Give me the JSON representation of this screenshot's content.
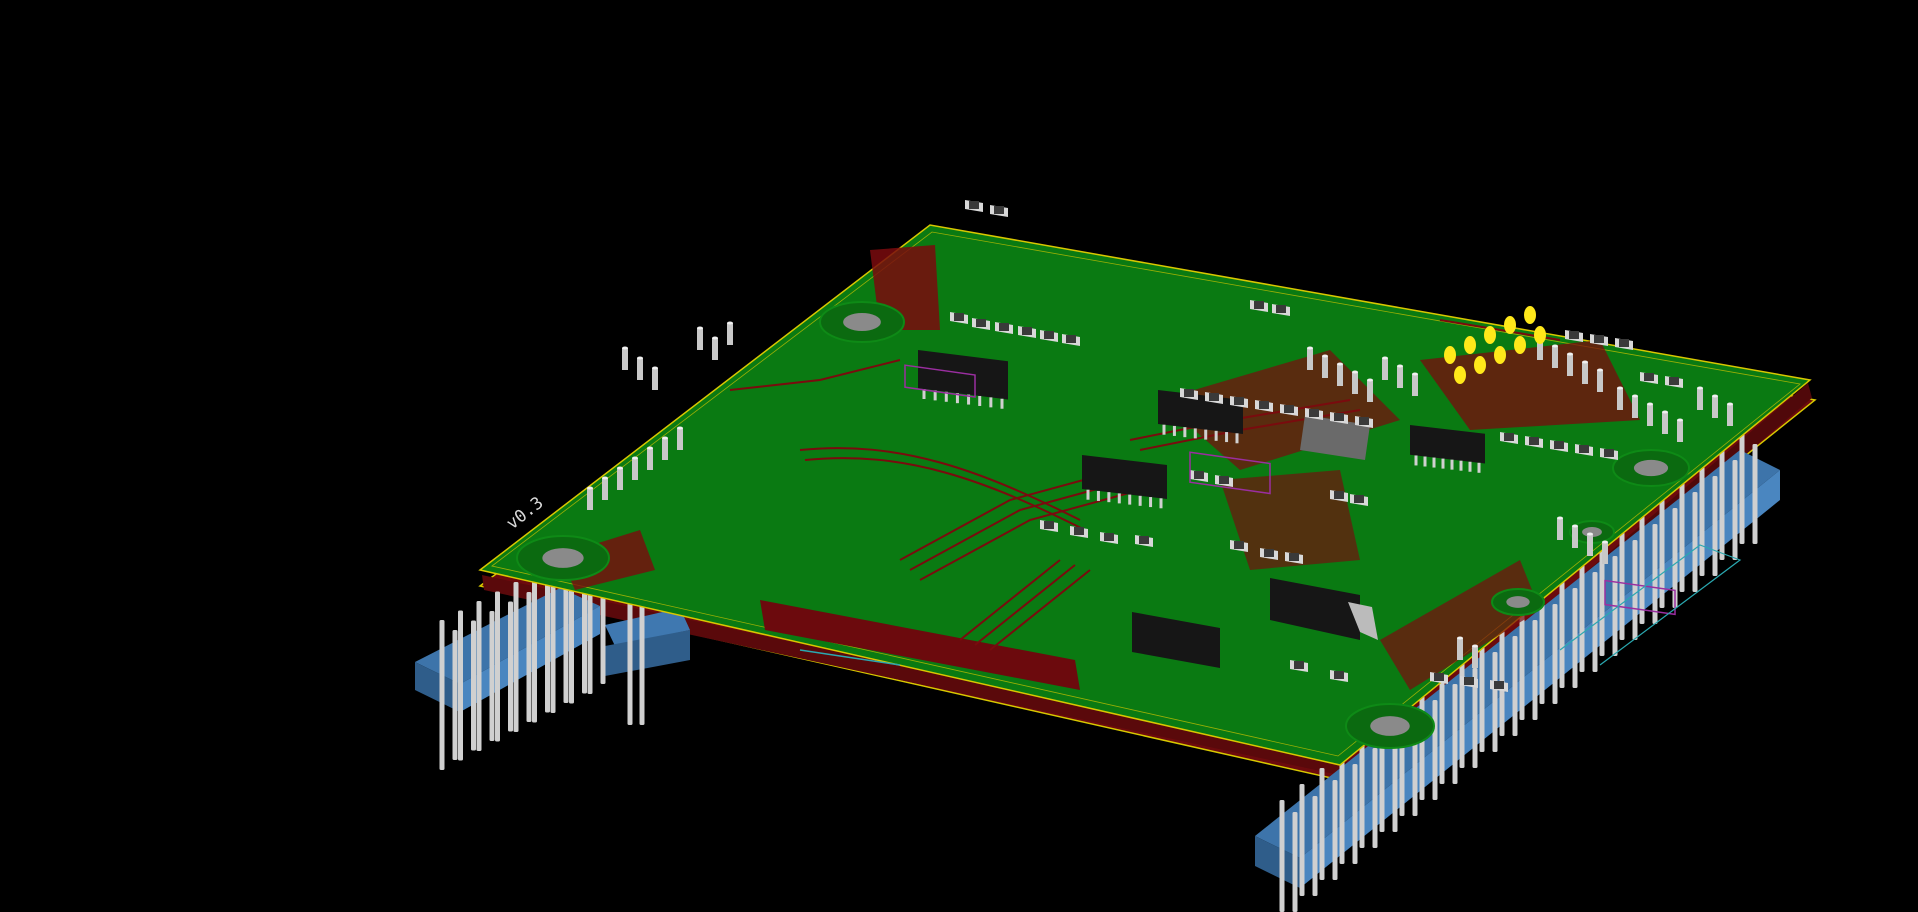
{
  "viewer": {
    "background_color": "#000000",
    "board": {
      "revision_text": "v0.3",
      "solder_mask_color": "#0a7a12",
      "copper_color": "#7a0b0e",
      "silkscreen_color": "#d8d8d8",
      "edge_cut_color": "#d8c800",
      "courtyard_color": "#9a2ea0",
      "header_color": "#4a86c0",
      "pin_color": "#d0d0d0",
      "ic_color": "#161616",
      "led_color": "#ffe81a"
    }
  }
}
